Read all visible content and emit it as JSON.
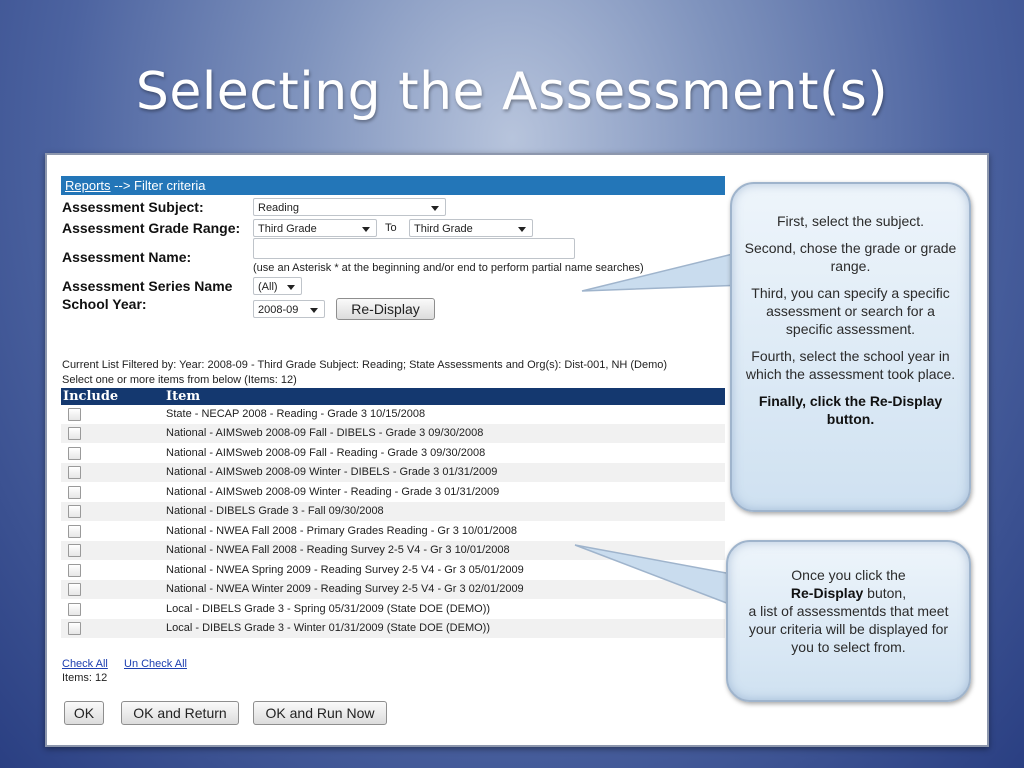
{
  "slide": {
    "title": "Selecting the Assessment(s)"
  },
  "breadcrumb": {
    "link": "Reports",
    "rest": "--> Filter criteria"
  },
  "form": {
    "subject_label": "Assessment Subject:",
    "subject_value": "Reading",
    "grade_label": "Assessment Grade Range:",
    "grade_from": "Third Grade",
    "to_label": "To",
    "grade_to": "Third Grade",
    "name_label": "Assessment Name:",
    "name_value": "",
    "name_hint": "(use an Asterisk * at the beginning and/or end to perform partial name searches)",
    "series_label": "Assessment Series Name",
    "series_value": "(All)",
    "year_label": "School Year:",
    "year_value": "2008-09",
    "redisplay_label": "Re-Display"
  },
  "filter_info": {
    "line1": "Current List Filtered by: Year: 2008-09 - Third Grade Subject: Reading; State Assessments and Org(s): Dist-001, NH (Demo)",
    "line2": "Select one or more items from below (Items: 12)"
  },
  "table": {
    "headers": [
      "Include",
      "Item"
    ],
    "rows": [
      "State - NECAP 2008 - Reading - Grade 3 10/15/2008",
      "National - AIMSweb 2008-09 Fall - DIBELS - Grade 3 09/30/2008",
      "National - AIMSweb 2008-09 Fall - Reading - Grade 3 09/30/2008",
      "National - AIMSweb 2008-09 Winter - DIBELS - Grade 3 01/31/2009",
      "National - AIMSweb 2008-09 Winter - Reading - Grade 3 01/31/2009",
      "National - DIBELS Grade 3 - Fall 09/30/2008",
      "National - NWEA Fall 2008 - Primary Grades Reading - Gr 3 10/01/2008",
      "National - NWEA Fall 2008 - Reading Survey 2-5 V4 - Gr 3 10/01/2008",
      "National - NWEA Spring 2009 - Reading Survey 2-5 V4 - Gr 3 05/01/2009",
      "National - NWEA Winter 2009 - Reading Survey 2-5 V4 - Gr 3 02/01/2009",
      "Local - DIBELS Grade 3 - Spring 05/31/2009 (State DOE (DEMO))",
      "Local - DIBELS Grade 3 - Winter 01/31/2009 (State DOE (DEMO))"
    ]
  },
  "footer": {
    "check_all": "Check All",
    "uncheck_all": "Un Check All",
    "items_count": "Items: 12",
    "ok": "OK",
    "ok_return": "OK and Return",
    "ok_run": "OK and Run Now"
  },
  "callout1": {
    "p1": "First, select the subject.",
    "p2": "Second, chose the grade or grade range.",
    "p3": "Third, you can specify a specific assessment or search for a specific assessment.",
    "p4": "Fourth, select the school year in which the assessment took place.",
    "p5": "Finally, click the Re-Display button."
  },
  "callout2": {
    "l1": "Once you click the",
    "l2": "Re-Display",
    "l3": " buton,",
    "l4": "a list of assessmentds that meet your criteria will be displayed for you to select from."
  },
  "colors": {
    "header_bar": "#2376b8",
    "table_header": "#14386f",
    "link": "#1d3fb0"
  }
}
